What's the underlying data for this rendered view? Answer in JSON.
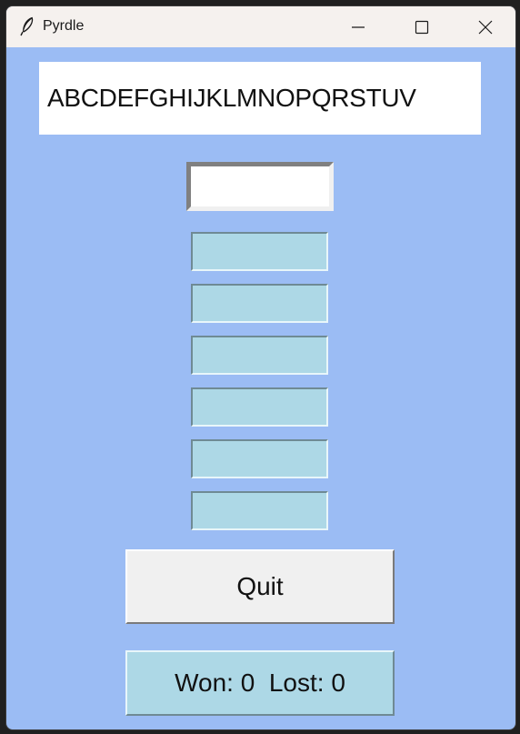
{
  "window": {
    "title": "Pyrdle",
    "icon": "feather-icon",
    "controls": [
      "minimize-icon",
      "maximize-icon",
      "close-icon"
    ]
  },
  "letters": {
    "text": "ABCDEFGHIJKLMNOPQRSTUV"
  },
  "entry": {
    "value": "",
    "placeholder": ""
  },
  "guesses": [
    "",
    "",
    "",
    "",
    "",
    ""
  ],
  "quit_button": {
    "label": "Quit"
  },
  "score": {
    "text": "Won: 0  Lost: 0",
    "won": 0,
    "lost": 0
  },
  "colors": {
    "background": "#9bbcf4",
    "guess_box": "#add8e6",
    "titlebar": "#f5f1ee"
  }
}
